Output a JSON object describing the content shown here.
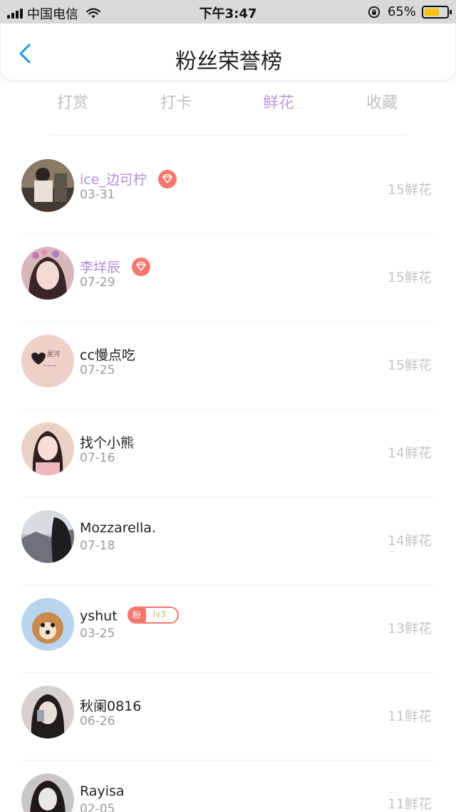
{
  "status_bar": {
    "carrier": "中国电信",
    "time": "下午3:47",
    "battery": "65%",
    "battery_level": 0.65
  },
  "header": {
    "title": "粉丝荣誉榜"
  },
  "tabs": [
    {
      "label": "打赏",
      "active": false
    },
    {
      "label": "打卡",
      "active": false
    },
    {
      "label": "鲜花",
      "active": true
    },
    {
      "label": "收藏",
      "active": false
    }
  ],
  "fans": [
    {
      "name": "ice_边可柠",
      "date": "03-31",
      "count": "15鲜花",
      "badge": "diamond"
    },
    {
      "name": "李垟辰",
      "date": "07-29",
      "count": "15鲜花",
      "badge": "diamond"
    },
    {
      "name": "cc慢点吃",
      "date": "07-25",
      "count": "15鲜花"
    },
    {
      "name": "找个小熊",
      "date": "07-16",
      "count": "14鲜花"
    },
    {
      "name": "Mozzarella.",
      "date": "07-18",
      "count": "14鲜花"
    },
    {
      "name": "yshut",
      "date": "03-25",
      "count": "13鲜花",
      "badge": "fan",
      "fan_label": "粉",
      "fan_level": "lv3"
    },
    {
      "name": "秋阑0816",
      "date": "06-26",
      "count": "11鲜花"
    },
    {
      "name": "Rayisa",
      "date": "02-05",
      "count": "11鲜花"
    }
  ],
  "colors": {
    "accent": "#c29ad9",
    "vip_name": "#b68bd6",
    "badge": "#f4776e",
    "muted": "#c4c4c4",
    "back_arrow": "#2a9be8"
  }
}
